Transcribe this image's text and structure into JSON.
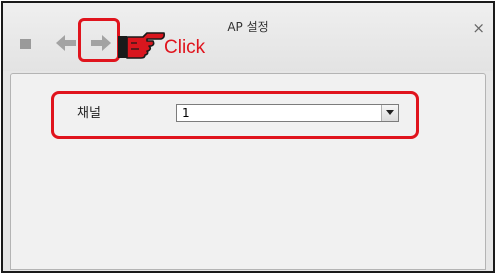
{
  "window": {
    "title": "AP 설정",
    "close_glyph": "×"
  },
  "toolbar": {
    "icons": [
      "stop-icon",
      "back-arrow-icon",
      "forward-arrow-icon"
    ]
  },
  "annotation": {
    "click_label": "Click",
    "highlight_color": "#e0141d",
    "pointer_icon": "pointing-hand-icon"
  },
  "channel": {
    "label": "채널",
    "selected_value": "1"
  }
}
